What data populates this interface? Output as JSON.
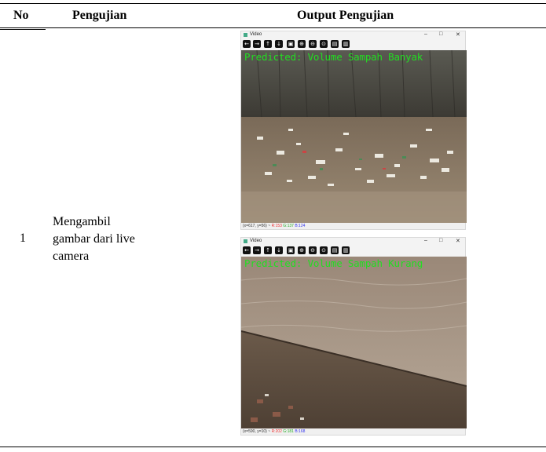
{
  "table": {
    "headers": {
      "no": "No",
      "pengujian": "Pengujian",
      "output": "Output Pengujian"
    },
    "rows": [
      {
        "no": "1",
        "pengujian_lines": [
          "Mengambil",
          "gambar dari live",
          "camera"
        ]
      }
    ]
  },
  "windows": [
    {
      "title": "Video",
      "prediction": "Predicted: Volume Sampah Banyak",
      "status": {
        "coords": "(x=617, y=56) ~",
        "r": "R:153",
        "g": "G:137",
        "b": "B:124"
      }
    },
    {
      "title": "Video",
      "prediction": "Predicted: Volume Sampah Kurang",
      "status": {
        "coords": "(x=590, y=10) ~",
        "r": "R:202",
        "g": "G:181",
        "b": "B:168"
      }
    }
  ],
  "window_controls": {
    "minimize": "–",
    "maximize": "□",
    "close": "✕"
  },
  "toolbar_icons": [
    "arrow-left-icon",
    "arrow-right-icon",
    "arrow-up-icon",
    "arrow-down-icon",
    "save-icon",
    "zoom-in-icon",
    "zoom-out-icon",
    "zoom-reset-icon",
    "copy-icon",
    "properties-icon"
  ],
  "colors": {
    "prediction_text": "#22dd22"
  }
}
